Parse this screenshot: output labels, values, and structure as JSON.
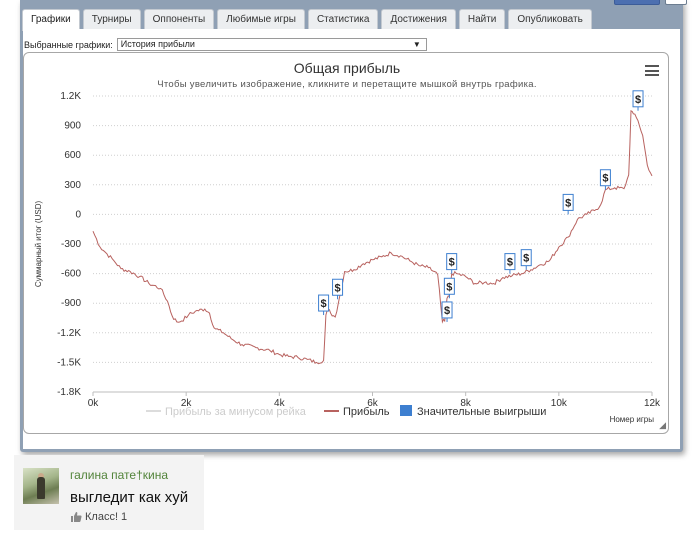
{
  "tabs": [
    {
      "label": "Графики",
      "active": true
    },
    {
      "label": "Турниры",
      "active": false
    },
    {
      "label": "Оппоненты",
      "active": false
    },
    {
      "label": "Любимые игры",
      "active": false
    },
    {
      "label": "Статистика",
      "active": false
    },
    {
      "label": "Достижения",
      "active": false
    },
    {
      "label": "Найти",
      "active": false
    },
    {
      "label": "Опубликовать",
      "active": false
    }
  ],
  "selector": {
    "label": "Выбранные графики:",
    "value": "История прибыли"
  },
  "chart_data": {
    "type": "line",
    "title": "Общая прибыль",
    "subtitle": "Чтобы увеличить изображение, кликните и перетащите мышкой внутрь графика.",
    "xlabel": "Номер игры",
    "ylabel": "Суммарный итог (USD)",
    "xlim": [
      0,
      12000
    ],
    "ylim": [
      -1800,
      1200
    ],
    "x_ticks": [
      "0k",
      "2k",
      "4k",
      "6k",
      "8k",
      "10k",
      "12k"
    ],
    "y_ticks": [
      "1.2K",
      "900",
      "600",
      "300",
      "0",
      "-300",
      "-600",
      "-900",
      "-1.2K",
      "-1.5K",
      "-1.8K"
    ],
    "series": [
      {
        "name": "Прибыль",
        "color": "#b8625f",
        "x": [
          0,
          150,
          300,
          450,
          600,
          800,
          1000,
          1200,
          1450,
          1600,
          1700,
          1800,
          1900,
          2050,
          2200,
          2400,
          2500,
          2600,
          2800,
          3000,
          3200,
          3500,
          3800,
          4000,
          4200,
          4400,
          4600,
          4800,
          4950,
          5000,
          5050,
          5100,
          5200,
          5300,
          5400,
          5600,
          5800,
          6000,
          6200,
          6400,
          6600,
          6800,
          7000,
          7200,
          7400,
          7500,
          7550,
          7600,
          7650,
          7700,
          7800,
          8000,
          8200,
          8400,
          8600,
          8800,
          9000,
          9200,
          9400,
          9600,
          9800,
          10000,
          10200,
          10400,
          10600,
          10800,
          10900,
          11000,
          11200,
          11400,
          11500,
          11550,
          11600,
          11700,
          11800,
          11900,
          12000
        ],
        "y": [
          -170,
          -330,
          -400,
          -470,
          -550,
          -580,
          -630,
          -700,
          -750,
          -880,
          -1030,
          -1090,
          -1080,
          -1020,
          -980,
          -960,
          -1000,
          -1150,
          -1200,
          -1270,
          -1320,
          -1350,
          -1380,
          -1420,
          -1440,
          -1450,
          -1470,
          -1500,
          -1480,
          -1020,
          -960,
          -1000,
          -1040,
          -820,
          -580,
          -560,
          -500,
          -460,
          -430,
          -390,
          -420,
          -470,
          -520,
          -540,
          -610,
          -1090,
          -1080,
          -850,
          -830,
          -600,
          -600,
          -630,
          -700,
          -690,
          -700,
          -640,
          -620,
          -600,
          -560,
          -510,
          -470,
          -330,
          -230,
          -50,
          0,
          50,
          100,
          250,
          270,
          260,
          400,
          1050,
          1020,
          950,
          800,
          500,
          390
        ]
      },
      {
        "name": "Прибыль за минусом рейка",
        "color": "#dcdcdc",
        "x": [],
        "y": []
      },
      {
        "name": "Значительные выигрыши",
        "color": "#3d7fd0",
        "marker": "$",
        "x": [
          4950,
          5250,
          7600,
          7650,
          7700,
          8950,
          9300,
          10200,
          11000,
          11700
        ],
        "y": [
          -1020,
          -860,
          -1090,
          -850,
          -600,
          -600,
          -560,
          0,
          250,
          1050
        ]
      }
    ],
    "legend_position": "bottom-center",
    "grid": "horizontal dotted"
  },
  "comment": {
    "author": "галина пате†кина",
    "text": "выгледит как хуй",
    "likes_label": "Класс! 1"
  }
}
